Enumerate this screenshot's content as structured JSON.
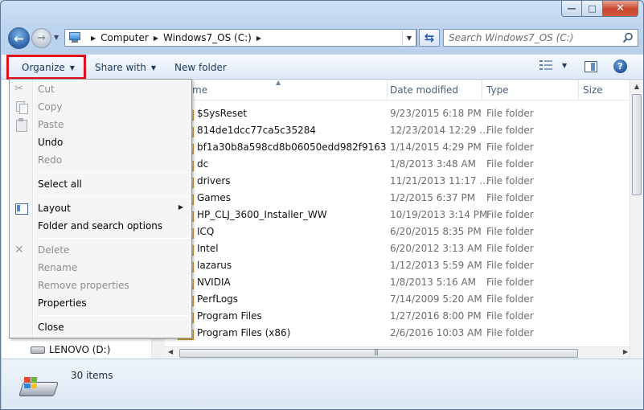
{
  "window": {
    "minimize_glyph": "—",
    "maximize_glyph": "□",
    "close_glyph": "✕"
  },
  "address": {
    "breadcrumbs": [
      "Computer",
      "Windows7_OS (C:)"
    ],
    "search_placeholder": "Search Windows7_OS (C:)"
  },
  "toolbar": {
    "organize_label": "Organize",
    "share_label": "Share with",
    "new_folder_label": "New folder"
  },
  "columns": {
    "name": "Name",
    "name_visible": "me",
    "date": "Date modified",
    "type": "Type",
    "size": "Size"
  },
  "files": [
    {
      "name": "$SysReset",
      "date": "9/23/2015 6:18 PM",
      "type": "File folder"
    },
    {
      "name": "814de1dcc77ca5c35284",
      "date": "12/23/2014 12:29 ...",
      "type": "File folder"
    },
    {
      "name": "bf1a30b8a598cd8b06050edd982f9163",
      "date": "1/14/2015 4:29 PM",
      "type": "File folder"
    },
    {
      "name": "dc",
      "date": "1/8/2013 3:48 AM",
      "type": "File folder"
    },
    {
      "name": "drivers",
      "date": "11/21/2013 11:17 ...",
      "type": "File folder"
    },
    {
      "name": "Games",
      "date": "1/2/2015 6:37 PM",
      "type": "File folder"
    },
    {
      "name": "HP_CLJ_3600_Installer_WW",
      "date": "10/19/2013 3:14 PM",
      "type": "File folder"
    },
    {
      "name": "ICQ",
      "date": "6/20/2015 8:35 PM",
      "type": "File folder"
    },
    {
      "name": "Intel",
      "date": "6/20/2012 3:13 AM",
      "type": "File folder"
    },
    {
      "name": "lazarus",
      "date": "1/12/2013 5:59 AM",
      "type": "File folder"
    },
    {
      "name": "NVIDIA",
      "date": "1/8/2013 5:16 AM",
      "type": "File folder"
    },
    {
      "name": "PerfLogs",
      "date": "7/14/2009 5:20 AM",
      "type": "File folder"
    },
    {
      "name": "Program Files",
      "date": "1/27/2016 8:00 PM",
      "type": "File folder"
    },
    {
      "name": "Program Files (x86)",
      "date": "2/6/2016 10:03 AM",
      "type": "File folder"
    }
  ],
  "navpane": {
    "drive_label": "LENOVO (D:)"
  },
  "menu": {
    "items": [
      {
        "label": "Cut",
        "enabled": false,
        "icon": "scissors-icon"
      },
      {
        "label": "Copy",
        "enabled": false,
        "icon": "copy-icon"
      },
      {
        "label": "Paste",
        "enabled": false,
        "icon": "paste-icon"
      },
      {
        "label": "Undo",
        "enabled": true
      },
      {
        "label": "Redo",
        "enabled": false
      },
      {
        "label": "Select all",
        "enabled": true
      },
      {
        "label": "Layout",
        "enabled": true,
        "icon": "layout-icon",
        "submenu": true
      },
      {
        "label": "Folder and search options",
        "enabled": true
      },
      {
        "label": "Delete",
        "enabled": false,
        "icon": "delete-icon"
      },
      {
        "label": "Rename",
        "enabled": false
      },
      {
        "label": "Remove properties",
        "enabled": false
      },
      {
        "label": "Properties",
        "enabled": true
      },
      {
        "label": "Close",
        "enabled": true
      }
    ]
  },
  "status": {
    "item_count": "30 items"
  },
  "colors": {
    "highlight_border": "#e0101f",
    "disabled_text": "#8d8d8d",
    "secondary_text": "#6d6d6d"
  }
}
